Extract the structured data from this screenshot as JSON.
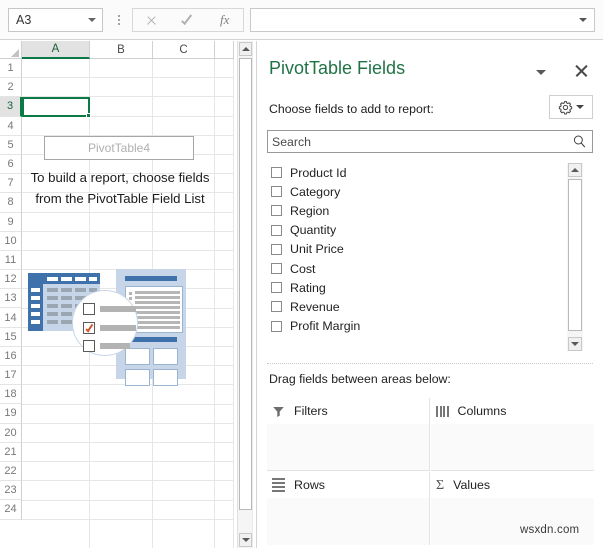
{
  "formula_bar": {
    "name_box_value": "A3",
    "name_box_arrow": "chevron-down-icon",
    "cancel_icon": "x-icon",
    "confirm_icon": "check-icon",
    "function_icon": "fx",
    "formula_value": "",
    "formula_expand_icon": "chevron-down-icon"
  },
  "sheet": {
    "column_headers": [
      "A",
      "B",
      "C"
    ],
    "selected_column": "A",
    "row_headers": [
      "1",
      "2",
      "3",
      "4",
      "5",
      "6",
      "7",
      "8",
      "9",
      "10",
      "11",
      "12",
      "13",
      "14",
      "15",
      "16",
      "17",
      "18",
      "19",
      "20",
      "21",
      "22",
      "23",
      "24"
    ],
    "selected_row": "3",
    "active_cell": "A3",
    "pivot_table_name": "PivotTable4",
    "pivot_placeholder_message": "To build a report, choose fields from the PivotTable Field List",
    "illustration_name": "pivottable-placeholder-illustration",
    "scrollbar": {
      "up_arrow": "triangle-up-icon",
      "down_arrow": "triangle-down-icon"
    }
  },
  "panel": {
    "title": "PivotTable Fields",
    "dropdown_icon": "chevron-down-icon",
    "close_icon": "close-icon",
    "choose_label": "Choose fields to add to report:",
    "tools_button": {
      "icon": "gear-icon",
      "arrow": "chevron-down-icon"
    },
    "search": {
      "value": "Search",
      "placeholder": "Search",
      "icon": "search-icon"
    },
    "fields": [
      {
        "label": "Product Id",
        "checked": false
      },
      {
        "label": "Category",
        "checked": false
      },
      {
        "label": "Region",
        "checked": false
      },
      {
        "label": "Quantity",
        "checked": false
      },
      {
        "label": "Unit Price",
        "checked": false
      },
      {
        "label": "Cost",
        "checked": false
      },
      {
        "label": "Rating",
        "checked": false
      },
      {
        "label": "Revenue",
        "checked": false
      },
      {
        "label": "Profit Margin",
        "checked": false
      }
    ],
    "field_scrollbar": {
      "up_arrow": "triangle-up-icon",
      "down_arrow": "triangle-down-icon"
    },
    "drag_label": "Drag fields between areas below:",
    "areas": [
      {
        "label": "Filters",
        "icon": "funnel-icon",
        "items": []
      },
      {
        "label": "Columns",
        "icon": "columns-icon",
        "items": []
      },
      {
        "label": "Rows",
        "icon": "rows-icon",
        "items": []
      },
      {
        "label": "Values",
        "icon": "sigma-icon",
        "items": []
      }
    ]
  },
  "watermark": "wsxdn.com",
  "colors": {
    "excel_green": "#217346",
    "selection_green": "#0c7a44",
    "illustration_blue": "#3f72aa",
    "illustration_light_blue": "#c6d5e8",
    "check_orange": "#d1552b"
  }
}
